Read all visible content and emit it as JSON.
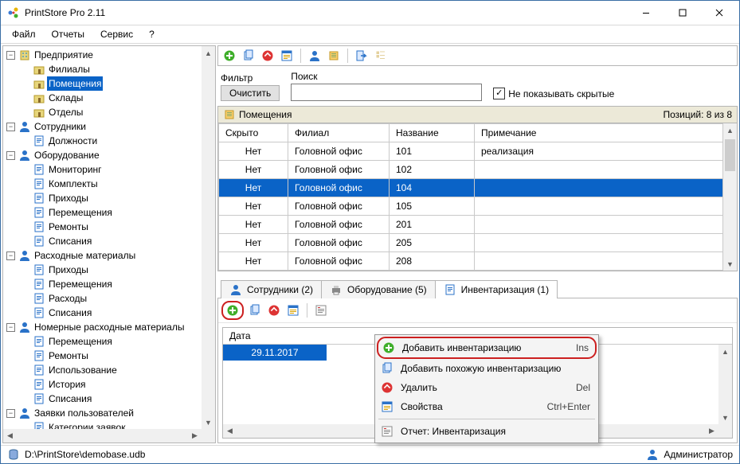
{
  "window": {
    "title": "PrintStore Pro 2.11"
  },
  "menu": {
    "items": [
      "Файл",
      "Отчеты",
      "Сервис",
      "?"
    ]
  },
  "tree": {
    "root": {
      "label": "Предприятие",
      "children": [
        {
          "label": "Филиалы"
        },
        {
          "label": "Помещения",
          "selected": true
        },
        {
          "label": "Склады"
        },
        {
          "label": "Отделы"
        }
      ]
    },
    "groups": [
      {
        "label": "Сотрудники",
        "children": [
          {
            "label": "Должности"
          }
        ]
      },
      {
        "label": "Оборудование",
        "children": [
          {
            "label": "Мониторинг"
          },
          {
            "label": "Комплекты"
          },
          {
            "label": "Приходы"
          },
          {
            "label": "Перемещения"
          },
          {
            "label": "Ремонты"
          },
          {
            "label": "Списания"
          }
        ]
      },
      {
        "label": "Расходные материалы",
        "children": [
          {
            "label": "Приходы"
          },
          {
            "label": "Перемещения"
          },
          {
            "label": "Расходы"
          },
          {
            "label": "Списания"
          }
        ]
      },
      {
        "label": "Номерные расходные материалы",
        "children": [
          {
            "label": "Перемещения"
          },
          {
            "label": "Ремонты"
          },
          {
            "label": "Использование"
          },
          {
            "label": "История"
          },
          {
            "label": "Списания"
          }
        ]
      },
      {
        "label": "Заявки пользователей",
        "children": [
          {
            "label": "Категории заявок"
          }
        ]
      }
    ]
  },
  "filter": {
    "label": "Фильтр",
    "clear": "Очистить",
    "search_label": "Поиск",
    "search_value": "",
    "hide_label": "Не показывать скрытые",
    "hide_checked": true
  },
  "grid": {
    "title": "Помещения",
    "counter": "Позиций: 8 из 8",
    "columns": [
      "Скрыто",
      "Филиал",
      "Название",
      "Примечание"
    ],
    "rows": [
      {
        "c": [
          "Нет",
          "Головной офис",
          "101",
          "реализация"
        ]
      },
      {
        "c": [
          "Нет",
          "Головной офис",
          "102",
          ""
        ]
      },
      {
        "c": [
          "Нет",
          "Головной офис",
          "104",
          ""
        ],
        "selected": true
      },
      {
        "c": [
          "Нет",
          "Головной офис",
          "105",
          ""
        ]
      },
      {
        "c": [
          "Нет",
          "Головной офис",
          "201",
          ""
        ]
      },
      {
        "c": [
          "Нет",
          "Головной офис",
          "205",
          ""
        ]
      },
      {
        "c": [
          "Нет",
          "Головной офис",
          "208",
          ""
        ]
      }
    ]
  },
  "tabs": [
    {
      "label": "Сотрудники (2)",
      "icon": "person"
    },
    {
      "label": "Оборудование (5)",
      "icon": "printer"
    },
    {
      "label": "Инвентаризация (1)",
      "icon": "sheet",
      "active": true
    }
  ],
  "list2": {
    "header": "Дата",
    "rows": [
      {
        "label": "29.11.2017",
        "selected": true
      }
    ]
  },
  "context": {
    "items": [
      {
        "icon": "add",
        "label": "Добавить инвентаризацию",
        "hot": "Ins",
        "hl": true
      },
      {
        "icon": "copy",
        "label": "Добавить похожую инвентаризацию",
        "hot": ""
      },
      {
        "icon": "delete",
        "label": "Удалить",
        "hot": "Del"
      },
      {
        "icon": "props",
        "label": "Свойства",
        "hot": "Ctrl+Enter"
      },
      {
        "sep": true
      },
      {
        "icon": "report",
        "label": "Отчет: Инвентаризация",
        "hot": ""
      }
    ]
  },
  "status": {
    "path": "D:\\PrintStore\\demobase.udb",
    "user": "Администратор"
  }
}
